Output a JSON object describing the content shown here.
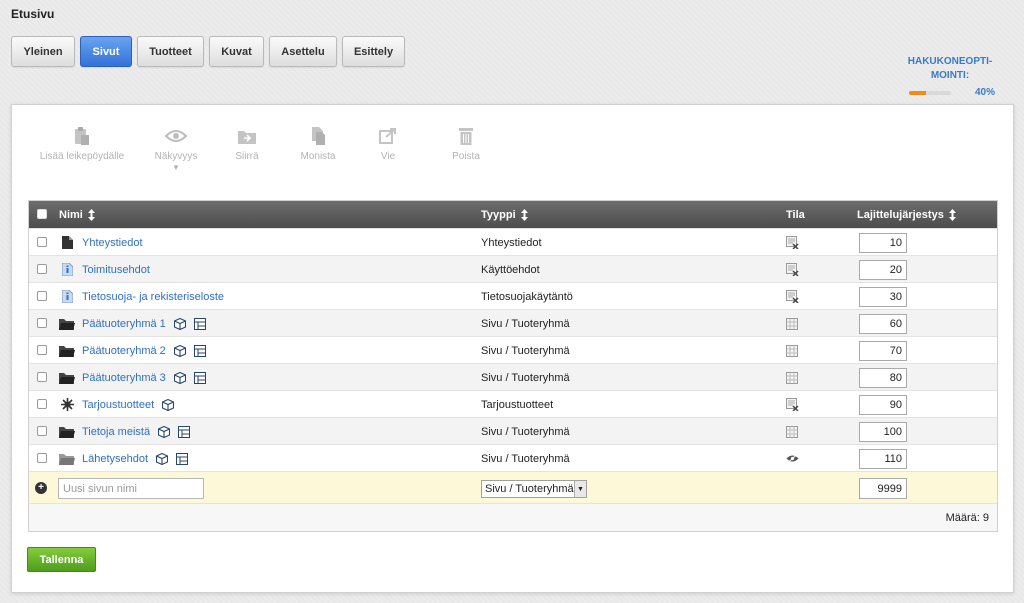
{
  "page": {
    "title": "Etusivu"
  },
  "tabs": [
    {
      "label": "Yleinen",
      "active": false
    },
    {
      "label": "Sivut",
      "active": true
    },
    {
      "label": "Tuotteet",
      "active": false
    },
    {
      "label": "Kuvat",
      "active": false
    },
    {
      "label": "Asettelu",
      "active": false
    },
    {
      "label": "Esittely",
      "active": false
    }
  ],
  "seo": {
    "label_line1": "HAKUKONEOPTI-",
    "label_line2": "MOINTI:",
    "percent_text": "40%",
    "progress": 0.4,
    "bar_color": "#f08c1a"
  },
  "toolbar": {
    "clipboard": "Lisää leikepöydälle",
    "visibility": "Näkyvyys",
    "move": "Siirrä",
    "duplicate": "Monista",
    "export": "Vie",
    "delete": "Poista"
  },
  "table": {
    "headers": {
      "name": "Nimi",
      "type": "Tyyppi",
      "state": "Tila",
      "order": "Lajittelujärjestys"
    },
    "rows": [
      {
        "name": "Yhteystiedot",
        "icon": "document-icon",
        "type": "Yhteystiedot",
        "state": "hidden-icon",
        "order": "10",
        "extra": []
      },
      {
        "name": "Toimitusehdot",
        "icon": "info-doc-icon",
        "type": "Käyttöehdot",
        "state": "hidden-icon",
        "order": "20",
        "extra": []
      },
      {
        "name": "Tietosuoja- ja rekisteriseloste",
        "icon": "info-doc-icon",
        "type": "Tietosuojakäytäntö",
        "state": "hidden-icon",
        "order": "30",
        "extra": []
      },
      {
        "name": "Päätuoteryhmä 1",
        "icon": "folder-icon",
        "type": "Sivu / Tuoteryhmä",
        "state": "grid-icon",
        "order": "60",
        "extra": [
          "cube-icon",
          "layout-icon"
        ]
      },
      {
        "name": "Päätuoteryhmä 2",
        "icon": "folder-icon",
        "type": "Sivu / Tuoteryhmä",
        "state": "grid-icon",
        "order": "70",
        "extra": [
          "cube-icon",
          "layout-icon"
        ]
      },
      {
        "name": "Päätuoteryhmä 3",
        "icon": "folder-icon",
        "type": "Sivu / Tuoteryhmä",
        "state": "grid-icon",
        "order": "80",
        "extra": [
          "cube-icon",
          "layout-icon"
        ]
      },
      {
        "name": "Tarjoustuotteet",
        "icon": "star-burst-icon",
        "type": "Tarjoustuotteet",
        "state": "hidden-icon",
        "order": "90",
        "extra": [
          "cube-icon"
        ]
      },
      {
        "name": "Tietoja meistä",
        "icon": "folder-icon",
        "type": "Sivu / Tuoteryhmä",
        "state": "grid-icon",
        "order": "100",
        "extra": [
          "cube-icon",
          "layout-icon"
        ]
      },
      {
        "name": "Lähetysehdot",
        "icon": "folder-gray-icon",
        "type": "Sivu / Tuoteryhmä",
        "state": "eye-hidden-icon",
        "order": "110",
        "extra": [
          "cube-icon",
          "layout-icon"
        ]
      }
    ],
    "new_row": {
      "name_placeholder": "Uusi sivun nimi",
      "type_value": "Sivu / Tuoteryhmä",
      "order_value": "9999"
    },
    "count_text": "Määrä: 9"
  },
  "save_label": "Tallenna",
  "colors": {
    "accent": "#3372d8",
    "link": "#2f6fc6",
    "save": "#5aa823",
    "header": "#555555",
    "new_row_bg": "#fdf8d8"
  }
}
